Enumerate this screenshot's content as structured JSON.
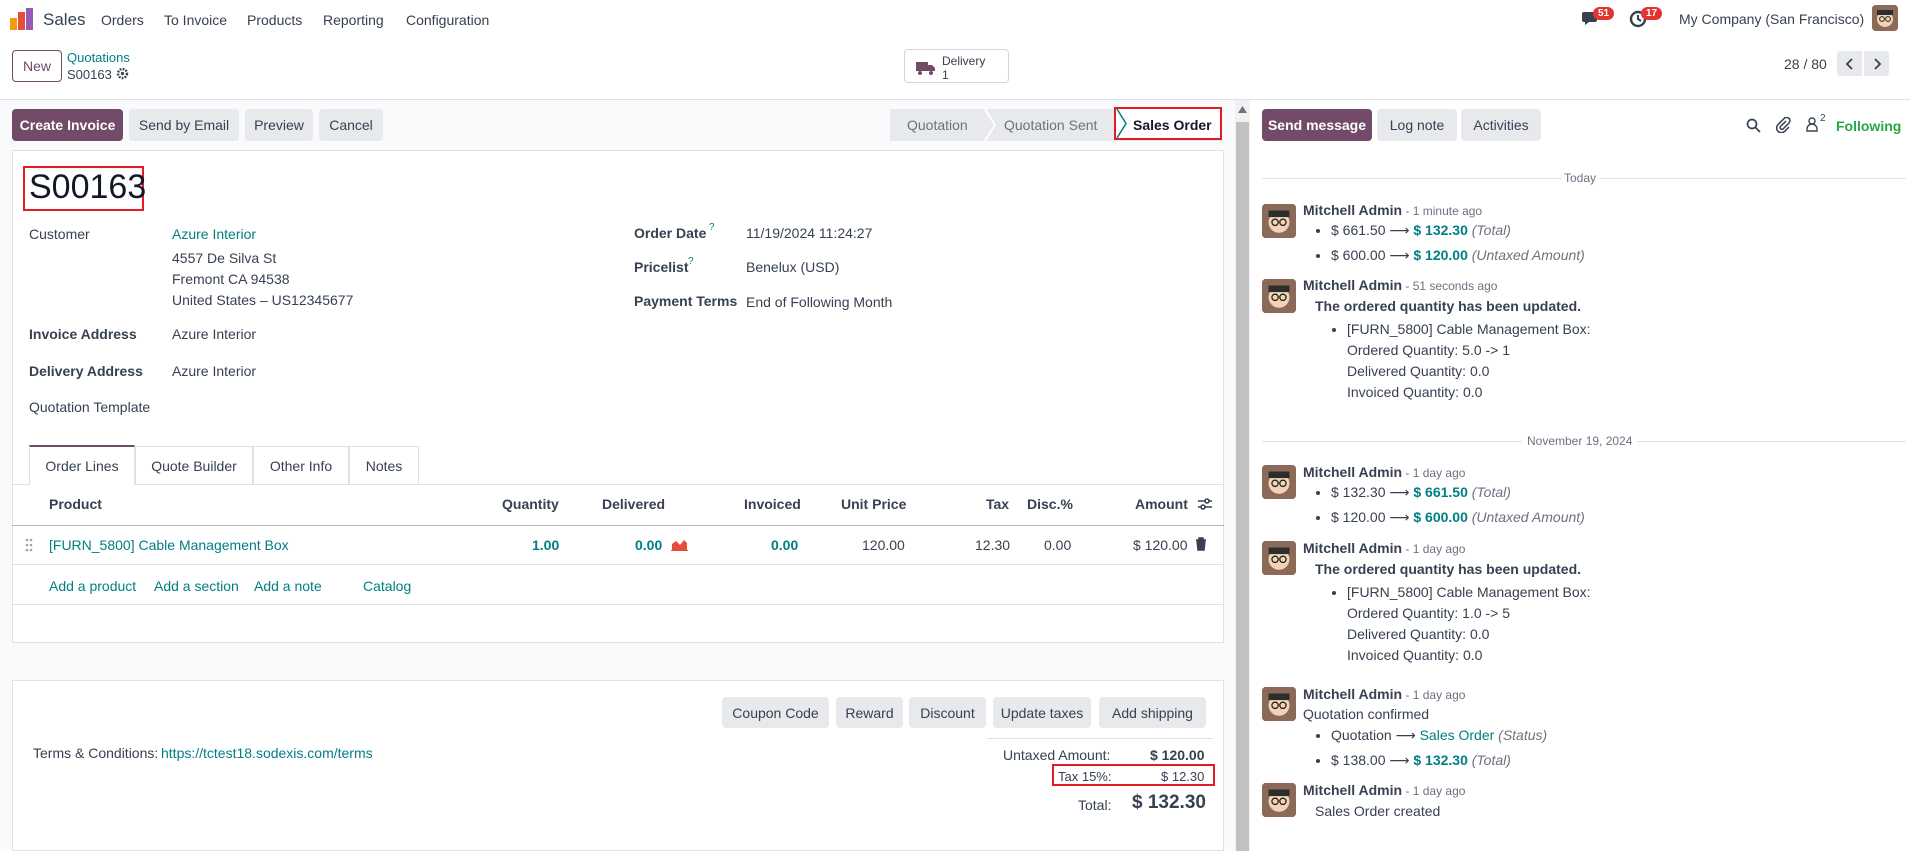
{
  "navbar": {
    "app_name": "Sales",
    "menu": [
      "Orders",
      "To Invoice",
      "Products",
      "Reporting",
      "Configuration"
    ],
    "messages_count": "51",
    "activities_count": "17",
    "company": "My Company (San Francisco)"
  },
  "control": {
    "new_label": "New",
    "breadcrumb_parent": "Quotations",
    "breadcrumb_current": "S00163",
    "smart_button_label": "Delivery",
    "smart_button_count": "1",
    "pager": "28 / 80"
  },
  "statusbar": {
    "actions": [
      "Create Invoice",
      "Send by Email",
      "Preview",
      "Cancel"
    ],
    "stages": [
      "Quotation",
      "Quotation Sent",
      "Sales Order"
    ],
    "active_stage": "Sales Order"
  },
  "form": {
    "name": "S00163",
    "customer_label": "Customer",
    "customer_name": "Azure Interior",
    "customer_address": [
      "4557 De Silva St",
      "Fremont CA 94538",
      "United States – US12345677"
    ],
    "invoice_address_label": "Invoice Address",
    "invoice_address": "Azure Interior",
    "delivery_address_label": "Delivery Address",
    "delivery_address": "Azure Interior",
    "template_label": "Quotation Template",
    "order_date_label": "Order Date",
    "order_date": "11/19/2024 11:24:27",
    "pricelist_label": "Pricelist",
    "pricelist": "Benelux (USD)",
    "payment_terms_label": "Payment Terms",
    "payment_terms": "End of Following Month",
    "help_mark": "?"
  },
  "tabs": [
    "Order Lines",
    "Quote Builder",
    "Other Info",
    "Notes"
  ],
  "table": {
    "headers": [
      "Product",
      "Quantity",
      "Delivered",
      "Invoiced",
      "Unit Price",
      "Tax",
      "Disc.%",
      "Amount"
    ],
    "row": {
      "product": "[FURN_5800] Cable Management Box",
      "quantity": "1.00",
      "delivered": "0.00",
      "invoiced": "0.00",
      "unit_price": "120.00",
      "tax": "12.30",
      "discount": "0.00",
      "amount": "$ 120.00"
    },
    "add_links": [
      "Add a product",
      "Add a section",
      "Add a note",
      "Catalog"
    ]
  },
  "bottom_buttons": [
    "Coupon Code",
    "Reward",
    "Discount",
    "Update taxes",
    "Add shipping"
  ],
  "terms": {
    "label": "Terms & Conditions:",
    "url": "https://tctest18.sodexis.com/terms"
  },
  "totals": {
    "untaxed_label": "Untaxed Amount:",
    "untaxed": "$ 120.00",
    "tax_label": "Tax 15%:",
    "tax": "$ 12.30",
    "total_label": "Total:",
    "total": "$ 132.30"
  },
  "chatter": {
    "send_message": "Send message",
    "log_note": "Log note",
    "activities": "Activities",
    "followers_count": "2",
    "following": "Following",
    "day_today": "Today",
    "day_nov": "November 19, 2024",
    "author": "Mitchell Admin",
    "sep": " - ",
    "arrow": "⟶",
    "m1": {
      "time": "1 minute ago",
      "a_old": "$ 661.50",
      "a_new": "$ 132.30",
      "a_field": "(Total)",
      "b_old": "$ 600.00",
      "b_new": "$ 120.00",
      "b_field": "(Untaxed Amount)"
    },
    "m2": {
      "time": "51 seconds ago",
      "title": "The ordered quantity has been updated.",
      "product": "[FURN_5800] Cable Management Box:",
      "ordered": "Ordered Quantity: 5.0 -> 1",
      "delivered": "Delivered Quantity: 0.0",
      "invoiced": "Invoiced Quantity: 0.0"
    },
    "m3": {
      "time": "1 day ago",
      "a_old": "$ 132.30",
      "a_new": "$ 661.50",
      "a_field": "(Total)",
      "b_old": "$ 120.00",
      "b_new": "$ 600.00",
      "b_field": "(Untaxed Amount)"
    },
    "m4": {
      "time": "1 day ago",
      "title": "The ordered quantity has been updated.",
      "product": "[FURN_5800] Cable Management Box:",
      "ordered": "Ordered Quantity: 1.0 -> 5",
      "delivered": "Delivered Quantity: 0.0",
      "invoiced": "Invoiced Quantity: 0.0"
    },
    "m5": {
      "time": "1 day ago",
      "body": "Quotation confirmed",
      "a_old": "Quotation",
      "a_new": "Sales Order",
      "a_field": "(Status)",
      "b_old": "$ 138.00",
      "b_new": "$ 132.30",
      "b_field": "(Total)"
    },
    "m6": {
      "time": "1 day ago",
      "body": "Sales Order created"
    }
  },
  "colors": {
    "brand": "#714b67",
    "link": "#017e84",
    "highlight": "#e31b23"
  }
}
